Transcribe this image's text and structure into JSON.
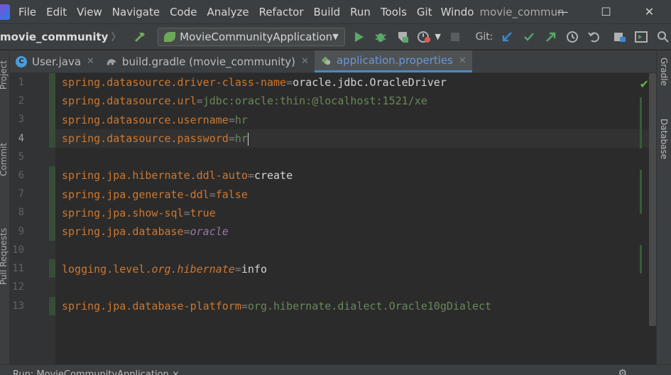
{
  "menu": {
    "items": [
      "File",
      "Edit",
      "View",
      "Navigate",
      "Code",
      "Analyze",
      "Refactor",
      "Build",
      "Run",
      "Tools",
      "Git",
      "Windo"
    ],
    "window_title": "movie_communit",
    "controls": {
      "minimize": "—",
      "maximize": "☐",
      "close": "✕"
    }
  },
  "toolbar": {
    "project": "movie_community",
    "run_config": "MovieCommunityApplication",
    "git_label": "Git:",
    "icons": [
      "hammer-icon",
      "run-icon",
      "debug-icon",
      "coverage-icon",
      "profile-icon",
      "stop-icon",
      "git-update-icon",
      "git-commit-icon",
      "git-push-icon",
      "history-icon",
      "rollback-icon",
      "project-structure-icon",
      "terminal-icon",
      "search-icon"
    ]
  },
  "tabs": [
    {
      "label": "User.java",
      "icon": "java-class-icon",
      "active": false
    },
    {
      "label": "build.gradle (movie_community)",
      "icon": "gradle-icon",
      "active": false
    },
    {
      "label": "application.properties",
      "icon": "spring-icon",
      "active": true
    }
  ],
  "side_panels": {
    "left": [
      "Project",
      "Commit",
      "Pull Requests"
    ],
    "right": [
      "Gradle",
      "Database"
    ]
  },
  "editor": {
    "current_line": 4,
    "lines": [
      {
        "num": "1",
        "key": "spring.datasource.driver-class-name",
        "eq": "=",
        "value": "oracle.jdbc.OracleDriver",
        "vclass": "w"
      },
      {
        "num": "2",
        "key": "spring.datasource.url",
        "eq": "=",
        "value": "jdbc:oracle:thin:@localhost:1521/xe",
        "vclass": "v"
      },
      {
        "num": "3",
        "key": "spring.datasource.username",
        "eq": "=",
        "value": "hr",
        "vclass": "v"
      },
      {
        "num": "4",
        "key": "spring.datasource.password",
        "eq": "=",
        "value": "hr",
        "vclass": "v"
      },
      {
        "num": "5",
        "key": "",
        "eq": "",
        "value": "",
        "vclass": "v"
      },
      {
        "num": "6",
        "key": "spring.jpa.hibernate.ddl-auto",
        "eq": "=",
        "value": "create",
        "vclass": "w"
      },
      {
        "num": "7",
        "key": "spring.jpa.generate-ddl",
        "eq": "=",
        "value": "false",
        "vclass": "k"
      },
      {
        "num": "8",
        "key": "spring.jpa.show-sql",
        "eq": "=",
        "value": "true",
        "vclass": "k"
      },
      {
        "num": "9",
        "key": "spring.jpa.database",
        "eq": "=",
        "value": "oracle",
        "vclass": "i"
      },
      {
        "num": "10",
        "key": "",
        "eq": "",
        "value": "",
        "vclass": "v"
      },
      {
        "num": "11",
        "key": "logging.level.",
        "key2": "org.hibernate",
        "eq": "=",
        "value": "info",
        "vclass": "w"
      },
      {
        "num": "12",
        "key": "",
        "eq": "",
        "value": "",
        "vclass": "v"
      },
      {
        "num": "13",
        "key": "spring.jpa.database-platform",
        "eq": "=",
        "value": "org.hibernate.dialect.Oracle10gDialect",
        "vclass": "v"
      }
    ]
  },
  "bottom": {
    "text": "Run:     MovieCommunityApplication ×"
  },
  "colors": {
    "background": "#2b2b2b",
    "key": "#cc7832",
    "string": "#6a8759",
    "active_tab_text": "#6897d8",
    "accent": "#4a88c7"
  }
}
